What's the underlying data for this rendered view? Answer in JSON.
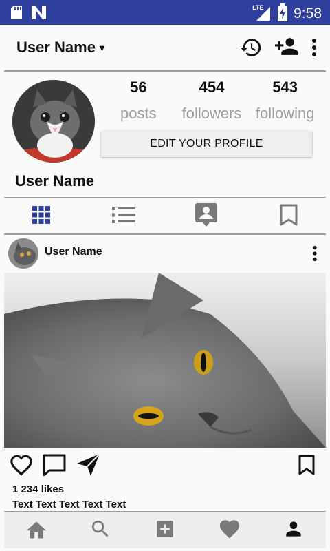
{
  "status_bar": {
    "time": "9:58",
    "network_label": "LTE",
    "icons": [
      "sd-card-icon",
      "n-notification-icon",
      "signal-icon",
      "battery-charging-icon"
    ]
  },
  "header": {
    "title": "User Name",
    "dropdown_caret": "▾",
    "actions": [
      "history-icon",
      "add-person-icon",
      "more-vert-icon"
    ]
  },
  "profile": {
    "name": "User Name",
    "stats": [
      {
        "value": "56",
        "label": "posts"
      },
      {
        "value": "454",
        "label": "followers"
      },
      {
        "value": "543",
        "label": "following"
      }
    ],
    "edit_button": "EDIT YOUR PROFILE"
  },
  "view_tabs": [
    {
      "icon": "grid-icon",
      "active": true
    },
    {
      "icon": "list-icon",
      "active": false
    },
    {
      "icon": "contact-icon",
      "active": false
    },
    {
      "icon": "bookmark-icon",
      "active": false
    }
  ],
  "post": {
    "user": "User Name",
    "likes": "1 234 likes",
    "caption": "Text Text Text Text Text",
    "actions": [
      "heart-icon",
      "comment-icon",
      "send-icon"
    ],
    "save_icon": "bookmark-icon"
  },
  "bottom_nav": [
    {
      "icon": "home-icon",
      "active": false
    },
    {
      "icon": "search-icon",
      "active": false
    },
    {
      "icon": "add-box-icon",
      "active": false
    },
    {
      "icon": "heart-icon",
      "active": false
    },
    {
      "icon": "person-icon",
      "active": true
    }
  ],
  "colors": {
    "status_bar": "#2f3f9e",
    "active_tab": "#2f3f9e",
    "inactive_icon": "#7a7a7a",
    "active_nav": "#111111",
    "background": "#fafafa"
  }
}
